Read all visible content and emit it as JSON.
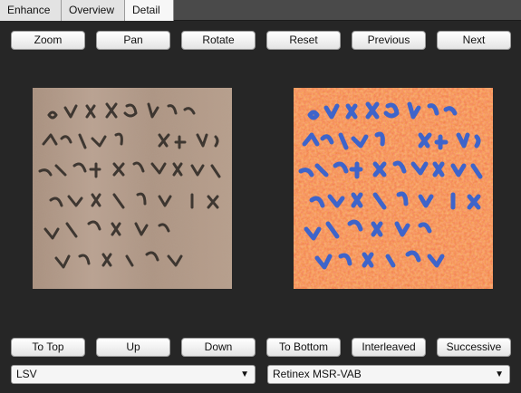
{
  "tabs": [
    {
      "label": "Enhance",
      "active": false
    },
    {
      "label": "Overview",
      "active": false
    },
    {
      "label": "Detail",
      "active": true
    }
  ],
  "top_toolbar": {
    "zoom": "Zoom",
    "pan": "Pan",
    "rotate": "Rotate",
    "reset": "Reset",
    "previous": "Previous",
    "next": "Next"
  },
  "bottom_toolbar": {
    "to_top": "To Top",
    "up": "Up",
    "down": "Down",
    "to_bottom": "To Bottom",
    "interleaved": "Interleaved",
    "successive": "Successive"
  },
  "left_panel": {
    "selected": "LSV",
    "arrow_icon": "triangle-down-icon"
  },
  "right_panel": {
    "selected": "Retinex MSR-VAB",
    "arrow_icon": "triangle-down-icon"
  },
  "colors": {
    "background": "#262626",
    "papyrus": "#b59a86",
    "ink": "#2a2622",
    "enhanced_base": "#f07a2c",
    "enhanced_ink": "#2b5fd6"
  }
}
